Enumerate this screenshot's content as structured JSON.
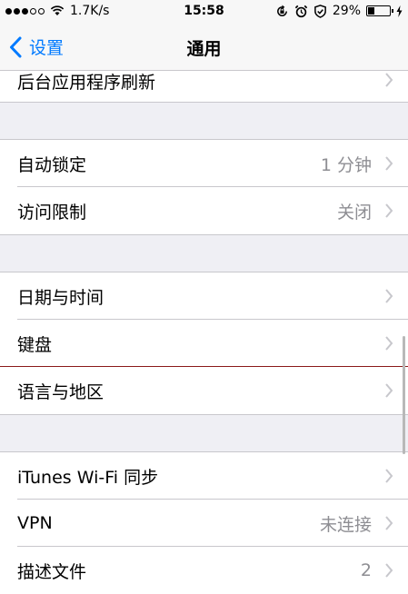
{
  "status_bar": {
    "signal_bars": 5,
    "signal_filled": 3,
    "network_speed": "1.7K/s",
    "time": "15:58",
    "battery_text": "29%",
    "battery_level": 0.29,
    "icons": [
      "wifi-icon",
      "rotation-lock-icon",
      "alarm-icon",
      "shield-icon",
      "charging-icon"
    ]
  },
  "nav": {
    "back_label": "设置",
    "title": "通用"
  },
  "rows": {
    "background_refresh": {
      "label": "后台应用程序刷新"
    },
    "auto_lock": {
      "label": "自动锁定",
      "value": "1 分钟"
    },
    "restrictions": {
      "label": "访问限制",
      "value": "关闭"
    },
    "date_time": {
      "label": "日期与时间"
    },
    "keyboard": {
      "label": "键盘"
    },
    "language_region": {
      "label": "语言与地区"
    },
    "itunes_sync": {
      "label": "iTunes Wi-Fi 同步"
    },
    "vpn": {
      "label": "VPN",
      "value": "未连接"
    },
    "profiles": {
      "label": "描述文件",
      "value": "2"
    }
  },
  "colors": {
    "accent": "#007aff",
    "background": "#efeff4",
    "secondary_text": "#8e8e93",
    "separator": "#c8c7cc"
  }
}
